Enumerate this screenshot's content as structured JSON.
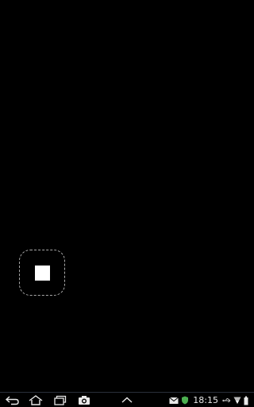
{
  "status_bar": {
    "time": "18:15",
    "icons": [
      "email-icon",
      "shield-icon",
      "usb-icon",
      "wifi-icon",
      "battery-icon"
    ]
  },
  "navigation": {
    "buttons": [
      "back-icon",
      "home-icon",
      "recent-apps-icon",
      "camera-icon",
      "chevron-up-icon"
    ]
  },
  "colors": {
    "background": "#000000",
    "icon": "#e8e8e8",
    "shield": "#4caf50",
    "stop_border": "#a9a9a9",
    "stop_square": "#ffffff"
  },
  "controls": {
    "stop_button_icon": "stop-icon"
  }
}
